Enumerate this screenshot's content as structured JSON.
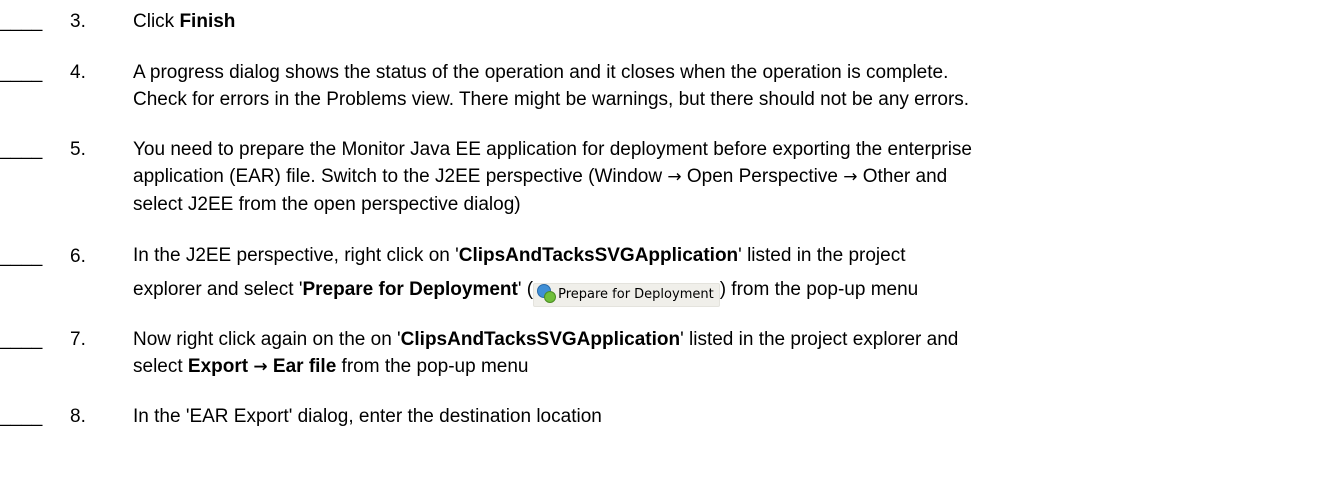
{
  "steps": [
    {
      "blank": "____",
      "number": "3.",
      "parts": {
        "a": "Click ",
        "b": "Finish"
      }
    },
    {
      "blank": "____",
      "number": "4.",
      "line1": "A progress dialog shows the status of the operation and it closes when the operation is complete.",
      "line2": "Check for errors in the Problems view.  There might be warnings, but there should not be any errors."
    },
    {
      "blank": "____",
      "number": "5.",
      "line1": "You need to prepare the Monitor Java EE application for deployment before exporting the enterprise",
      "line2a": "application (EAR) file. Switch to the J2EE perspective (Window ",
      "arrow1": "→",
      "line2b": " Open Perspective ",
      "arrow2": "→",
      "line2c": " Other and",
      "line3": "select J2EE from the open perspective dialog)"
    },
    {
      "blank": "____",
      "number": "6.",
      "l1a": "In the J2EE perspective, right click on '",
      "l1b": "ClipsAndTacksSVGApplication",
      "l1c": "' listed in the project",
      "l2a": "explorer and select '",
      "l2b": "Prepare for Deployment",
      "l2c": "' (",
      "icon_label": "Prepare for Deployment",
      "l2d": ") from the pop-up menu"
    },
    {
      "blank": "____",
      "number": "7.",
      "l1a": "Now right click again on the on '",
      "l1b": "ClipsAndTacksSVGApplication",
      "l1c": "' listed in the project explorer and",
      "l2a": "select ",
      "l2b": "Export ",
      "arrow": "→",
      "l2c": " Ear file",
      "l2d": " from the pop-up menu"
    },
    {
      "blank": "____",
      "number": "8.",
      "line1": "In the 'EAR Export' dialog, enter the destination location"
    }
  ]
}
